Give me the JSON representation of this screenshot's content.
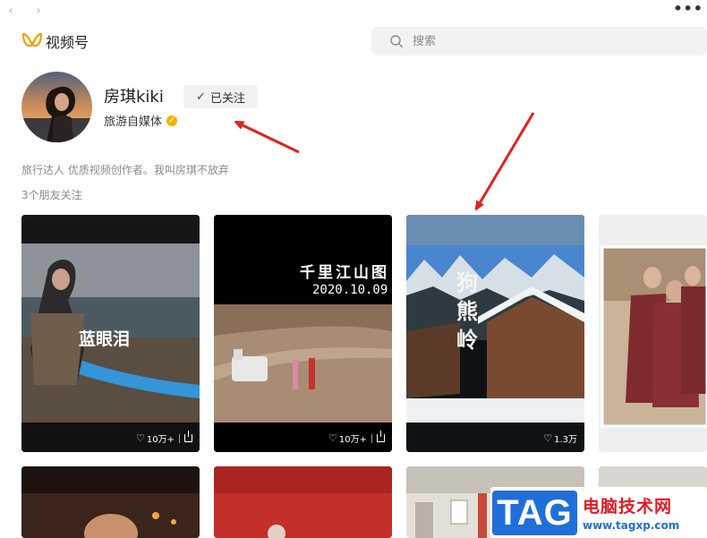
{
  "nav": {
    "back": "‹",
    "forward": "›",
    "more": "•••"
  },
  "header": {
    "brand_name": "视频号",
    "search_placeholder": "搜索",
    "brand_color": "#f0a000"
  },
  "profile": {
    "name": "房琪kiki",
    "follow_label": "已关注",
    "category": "旅游自媒体",
    "bio": "旅行达人 优质视频创作者。我叫房琪不放弃",
    "friends_following": "3个朋友关注"
  },
  "videos": [
    {
      "title": "蓝眼泪",
      "likes": "10万+",
      "shareable": true
    },
    {
      "title": "千里江山图",
      "date": "2020.10.09",
      "likes": "10万+",
      "shareable": true
    },
    {
      "title": "狗熊岭",
      "likes": "1.3万",
      "shareable": false
    },
    {
      "title": "",
      "likes": "",
      "shareable": false
    }
  ],
  "watermark": {
    "tag": "TAG",
    "site_name": "电脑技术网",
    "url": "www.tagxp.com"
  },
  "colors": {
    "annotation_arrow": "#e0231b",
    "watermark_blue": "#1f6fd9",
    "watermark_red": "#e41a23"
  }
}
